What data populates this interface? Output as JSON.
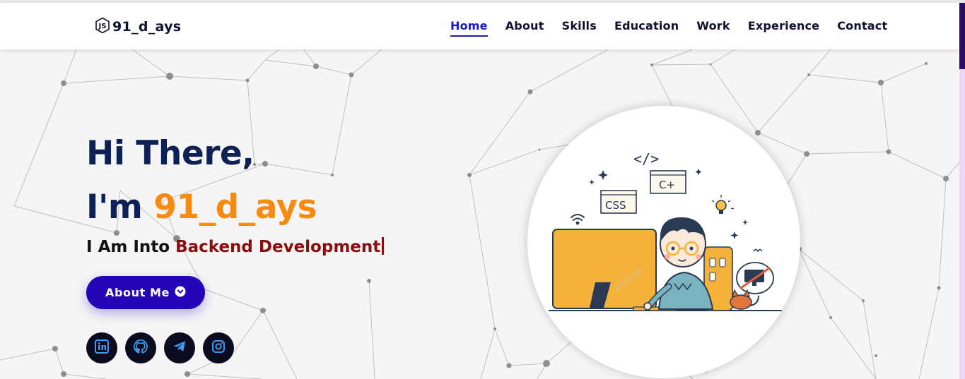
{
  "brand": {
    "name": "91_d_ays",
    "icon": "nodejs-hex-icon"
  },
  "nav": {
    "items": [
      {
        "label": "Home",
        "active": true
      },
      {
        "label": "About"
      },
      {
        "label": "Skills"
      },
      {
        "label": "Education"
      },
      {
        "label": "Work"
      },
      {
        "label": "Experience"
      },
      {
        "label": "Contact"
      }
    ]
  },
  "hero": {
    "greeting": "Hi There,",
    "intro_prefix": "I'm ",
    "intro_name": "91_d_ays",
    "typed_prefix": "I Am Into ",
    "typed_role": "Backend Development",
    "button_label": "About Me",
    "button_icon": "chevron-down-circle-icon"
  },
  "socials": [
    {
      "name": "linkedin",
      "icon": "linkedin-icon"
    },
    {
      "name": "github",
      "icon": "github-icon"
    },
    {
      "name": "telegram",
      "icon": "telegram-icon"
    },
    {
      "name": "instagram",
      "icon": "instagram-icon"
    }
  ],
  "illustration": {
    "code_tag": "</>",
    "badge_css": "CSS",
    "badge_cplus": "C+",
    "watermark": "pngtree"
  },
  "colors": {
    "navy": "#0d2157",
    "orange": "#f78a0f",
    "maroon": "#8c0b0b",
    "accent": "#2406b8",
    "nav_active": "#1a19c9"
  }
}
